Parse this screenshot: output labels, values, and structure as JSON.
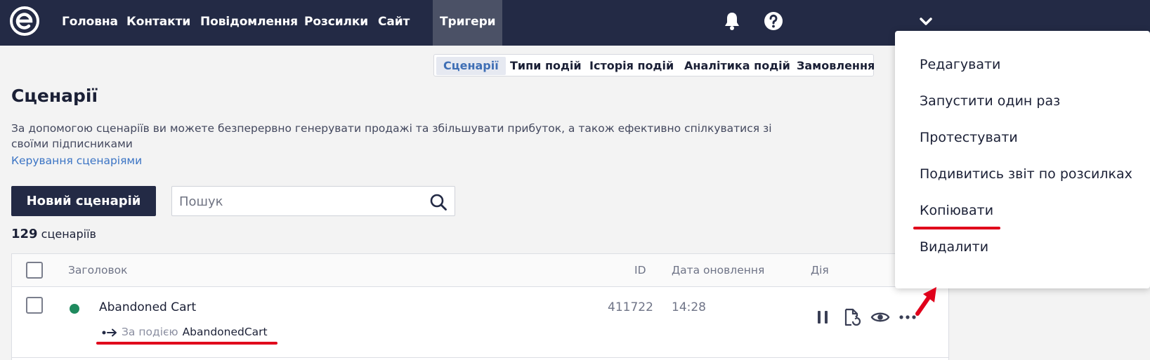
{
  "nav": {
    "items": [
      {
        "label": "Головна"
      },
      {
        "label": "Контакти"
      },
      {
        "label": "Повідомлення"
      },
      {
        "label": "Розсилки"
      },
      {
        "label": "Сайт"
      },
      {
        "label": "Тригери"
      }
    ],
    "active": "Тригери"
  },
  "subtabs": [
    {
      "label": "Сценарії"
    },
    {
      "label": "Типи подій"
    },
    {
      "label": "Історія подій"
    },
    {
      "label": "Аналітика подій"
    },
    {
      "label": "Замовлення"
    }
  ],
  "page": {
    "title": "Сценарії",
    "description": "За допомогою сценаріїв ви можете безперервно генерувати продажі та збільшувати прибуток, а також ефективно спілкуватися зі своїми підписниками",
    "manage_link": "Керування сценаріями",
    "new_button": "Новий сценарій",
    "search_placeholder": "Пошук",
    "count_number": "129",
    "count_label": "сценаріїв"
  },
  "table": {
    "columns": {
      "title": "Заголовок",
      "id": "ID",
      "date": "Дата оновлення",
      "action": "Дія"
    },
    "rows": [
      {
        "title": "Abandoned Cart",
        "trigger_label": "За подією",
        "event": "AbandonedCart",
        "id": "411722",
        "date": "14:28"
      }
    ]
  },
  "dropdown": {
    "items": [
      {
        "label": "Редагувати"
      },
      {
        "label": "Запустити один раз"
      },
      {
        "label": "Протестувати"
      },
      {
        "label": "Подивитись звіт по розсилках"
      },
      {
        "label": "Копіювати"
      },
      {
        "label": "Видалити"
      }
    ]
  },
  "colors": {
    "nav_bg": "#232a45",
    "accent_link": "#3b74c4",
    "status_active": "#1f8a5e",
    "highlight_red": "#e0001b"
  }
}
